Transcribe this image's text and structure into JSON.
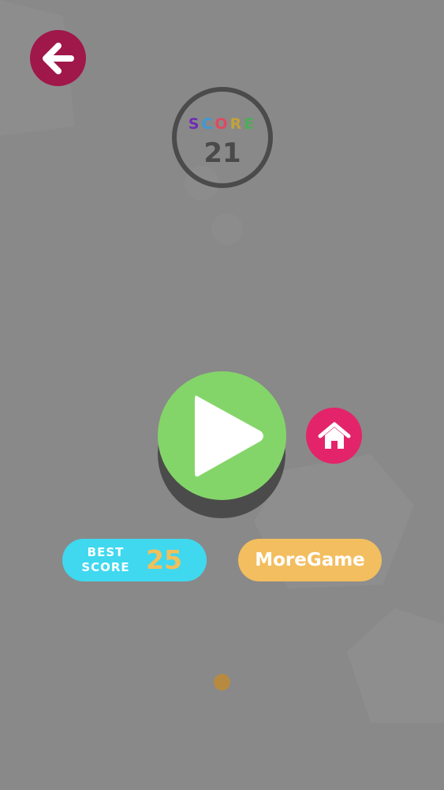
{
  "app": {
    "background_color": "#898989"
  },
  "back_button": {
    "icon": "arrow-left-icon",
    "color": "#a0174a"
  },
  "score": {
    "label_letters": [
      {
        "char": "S",
        "color": "#6f2db4"
      },
      {
        "char": "C",
        "color": "#3a9ad9"
      },
      {
        "char": "O",
        "color": "#e0495f"
      },
      {
        "char": "R",
        "color": "#c2a23b"
      },
      {
        "char": "E",
        "color": "#4cae57"
      }
    ],
    "value": "21"
  },
  "play_button": {
    "icon": "play-icon",
    "color": "#84d569"
  },
  "home_button": {
    "icon": "home-icon",
    "color": "#e3246a"
  },
  "best_score": {
    "label": "BEST\nSCORE",
    "value": "25",
    "color": "#40d8ef",
    "value_color": "#f0c05c"
  },
  "more_game": {
    "label": "MoreGame",
    "color": "#f3be5f"
  }
}
